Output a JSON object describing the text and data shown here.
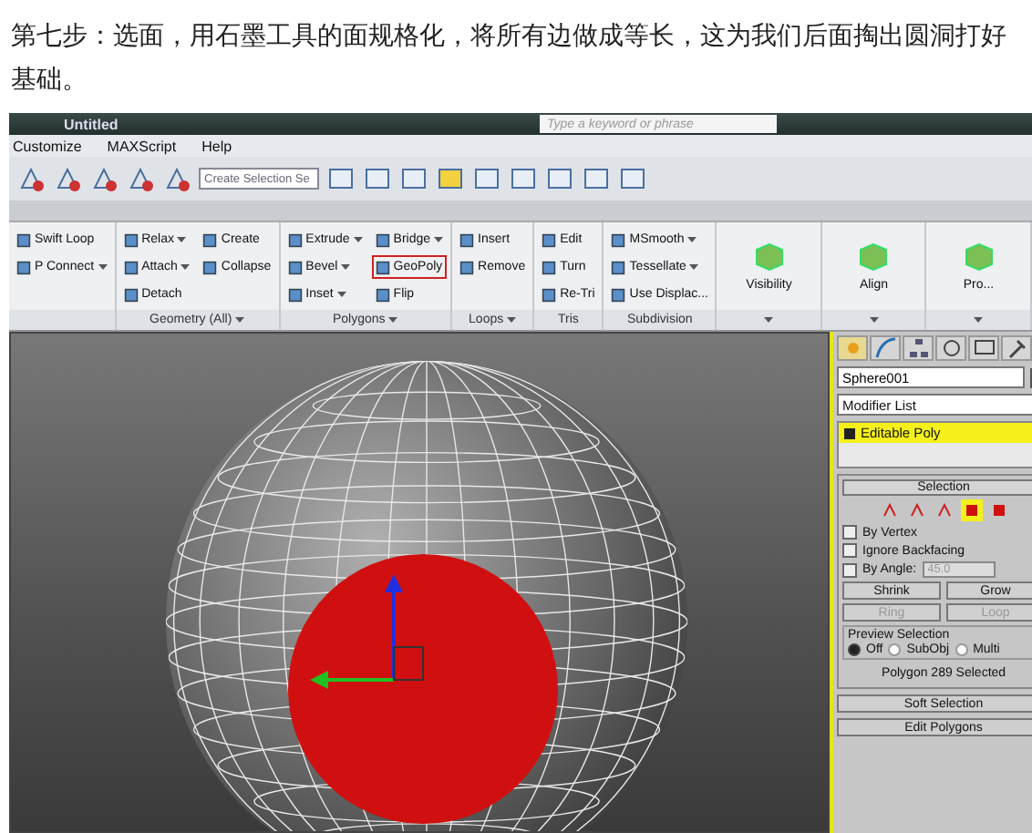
{
  "caption": "第七步：选面，用石墨工具的面规格化，将所有边做成等长，这为我们后面掏出圆洞打好基础。",
  "app": {
    "title": "Untitled",
    "search": {
      "placeholder": "Type a keyword or phrase"
    },
    "menu": [
      "Customize",
      "MAXScript",
      "Help"
    ],
    "selection_set": {
      "placeholder": "Create Selection Se"
    },
    "ribbon": [
      {
        "kind": "tools",
        "dropdown": false,
        "columns": [
          [
            {
              "label": "Swift Loop",
              "caret": false,
              "selected": false
            },
            {
              "label": "P Connect",
              "caret": true,
              "selected": false
            }
          ]
        ]
      },
      {
        "kind": "tools",
        "label": "Geometry (All)",
        "dropdown": true,
        "columns": [
          [
            {
              "label": "Relax",
              "caret": true,
              "selected": false
            },
            {
              "label": "Attach",
              "caret": true,
              "selected": false
            },
            {
              "label": "Detach",
              "caret": false,
              "selected": false
            }
          ],
          [
            {
              "label": "Create",
              "caret": false,
              "selected": false
            },
            {
              "label": "Collapse",
              "caret": false,
              "selected": false
            }
          ]
        ]
      },
      {
        "kind": "tools",
        "label": "Polygons",
        "dropdown": true,
        "columns": [
          [
            {
              "label": "Extrude",
              "caret": true,
              "selected": false
            },
            {
              "label": "Bevel",
              "caret": true,
              "selected": false
            },
            {
              "label": "Inset",
              "caret": true,
              "selected": false
            }
          ],
          [
            {
              "label": "Bridge",
              "caret": true,
              "selected": false
            },
            {
              "label": "GeoPoly",
              "caret": false,
              "selected": true
            },
            {
              "label": "Flip",
              "caret": false,
              "selected": false
            }
          ]
        ]
      },
      {
        "kind": "tools",
        "label": "Loops",
        "dropdown": true,
        "columns": [
          [
            {
              "label": "Insert",
              "caret": false,
              "selected": false
            },
            {
              "label": "Remove",
              "caret": false,
              "selected": false
            }
          ]
        ]
      },
      {
        "kind": "tools",
        "label": "Tris",
        "dropdown": false,
        "columns": [
          [
            {
              "label": "Edit",
              "caret": false,
              "selected": false
            },
            {
              "label": "Turn",
              "caret": false,
              "selected": false
            },
            {
              "label": "Re-Tri",
              "caret": false,
              "selected": false
            }
          ]
        ]
      },
      {
        "kind": "tools",
        "label": "Subdivision",
        "dropdown": false,
        "columns": [
          [
            {
              "label": "MSmooth",
              "caret": true,
              "selected": false
            },
            {
              "label": "Tessellate",
              "caret": true,
              "selected": false
            },
            {
              "label": "Use Displac...",
              "caret": false,
              "selected": false
            }
          ]
        ]
      },
      {
        "kind": "big",
        "title": "Visibility",
        "dropdown": true
      },
      {
        "kind": "big",
        "title": "Align",
        "dropdown": true
      },
      {
        "kind": "big",
        "title": "Pro...",
        "dropdown": true
      }
    ],
    "panel": {
      "tabs": [
        {
          "selected": true
        },
        {
          "selected": false
        },
        {
          "selected": false
        },
        {
          "selected": false
        },
        {
          "selected": false
        },
        {
          "selected": false
        }
      ],
      "object_name": "Sphere001",
      "modifier_list": "Modifier List",
      "stack": [
        {
          "label": "Editable Poly",
          "selected": true
        }
      ],
      "selection": {
        "title": "Selection",
        "levels": [
          {
            "selected": false
          },
          {
            "selected": false
          },
          {
            "selected": false
          },
          {
            "selected": true
          },
          {
            "selected": false
          }
        ],
        "options": [
          {
            "label": "By Vertex",
            "checked": false
          },
          {
            "label": "Ignore Backfacing",
            "checked": false
          },
          {
            "label": "By Angle:",
            "checked": false,
            "value": "45.0"
          }
        ],
        "buttons": [
          {
            "label": "Shrink",
            "disabled": false
          },
          {
            "label": "Grow",
            "disabled": false
          },
          {
            "label": "Ring",
            "disabled": true
          },
          {
            "label": "Loop",
            "disabled": true
          }
        ],
        "preview": {
          "title": "Preview Selection",
          "options": [
            {
              "label": "Off",
              "selected": true
            },
            {
              "label": "SubObj",
              "selected": false
            },
            {
              "label": "Multi",
              "selected": false
            }
          ]
        },
        "status": "Polygon 289 Selected"
      },
      "rollouts": [
        "Soft Selection",
        "Edit Polygons"
      ]
    }
  }
}
